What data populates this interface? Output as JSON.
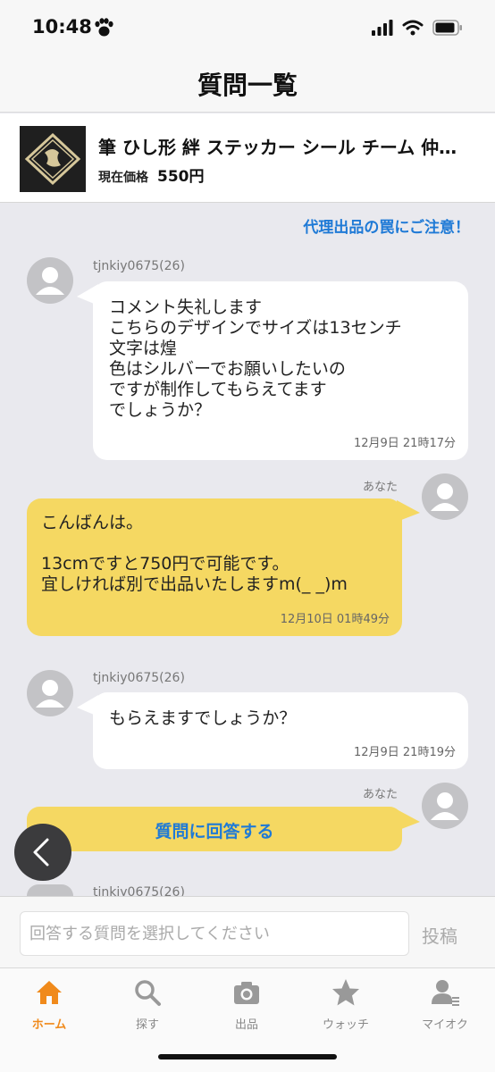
{
  "status_bar": {
    "time": "10:48"
  },
  "nav": {
    "title": "質問一覧"
  },
  "item": {
    "title": "筆 ひし形 絆 ステッカー シール チーム 仲…",
    "price_label": "現在価格",
    "price_value": "550円"
  },
  "warning_link": "代理出品の罠にご注意！",
  "messages": [
    {
      "sender": "tjnkiy0675(26)",
      "text": "コメント失礼します\nこちらのデザインでサイズは13センチ\n文字は煌\n色はシルバーでお願いしたいの\nですが制作してもらえてます\nでしょうか？",
      "time": "12月9日 21時17分"
    },
    {
      "sender": "あなた",
      "text": "こんばんは。\n\n13cmですと750円で可能です。\n宜しければ別で出品いたしますm(_ _)m",
      "time": "12月10日 01時49分"
    },
    {
      "sender": "tjnkiy0675(26)",
      "text": "もらえますでしょうか？",
      "time": "12月9日 21時19分"
    },
    {
      "sender": "あなた"
    },
    {
      "sender": "tjnkiy0675(26)"
    }
  ],
  "answer_button_label": "質問に回答する",
  "input": {
    "placeholder": "回答する質問を選択してください",
    "post_label": "投稿"
  },
  "tabs": [
    {
      "label": "ホーム",
      "icon": "home-icon",
      "active": true
    },
    {
      "label": "探す",
      "icon": "search-icon",
      "active": false
    },
    {
      "label": "出品",
      "icon": "camera-icon",
      "active": false
    },
    {
      "label": "ウォッチ",
      "icon": "star-icon",
      "active": false
    },
    {
      "label": "マイオク",
      "icon": "user-list-icon",
      "active": false
    }
  ],
  "colors": {
    "accent_blue": "#1f7ad6",
    "bubble_yellow": "#f5d862",
    "tab_active_orange": "#f08a1b"
  }
}
